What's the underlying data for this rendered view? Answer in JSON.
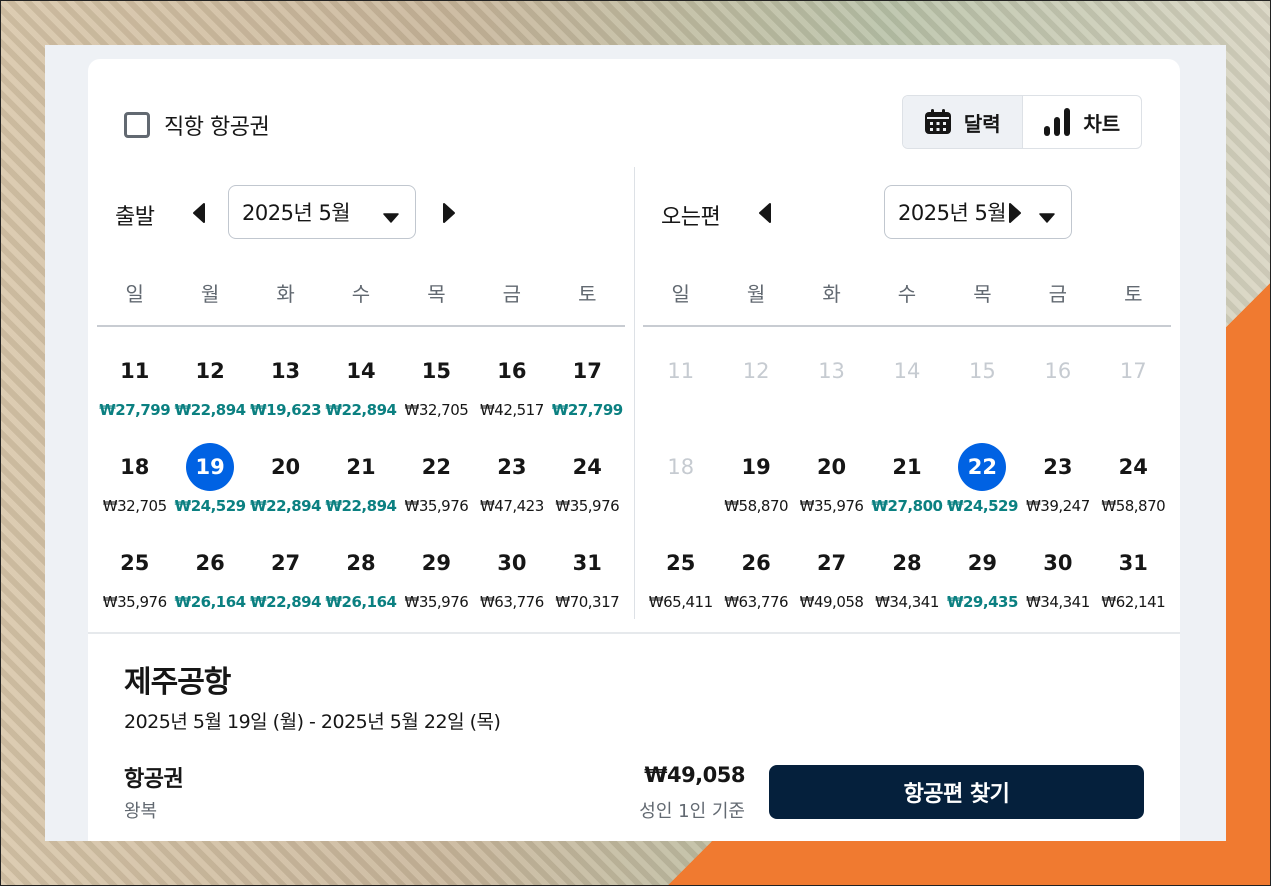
{
  "colors": {
    "accent": "#0062e3",
    "cheap_price": "#0b8081",
    "button_bg": "#05203c",
    "text": "#161616",
    "muted": "#626971",
    "disabled": "#c6cbd1"
  },
  "filters": {
    "direct_label": "직항 항공권",
    "direct_checked": false
  },
  "view_toggle": [
    {
      "label": "달력",
      "icon": "calendar-icon",
      "active": true
    },
    {
      "label": "차트",
      "icon": "bar-chart-icon",
      "active": false
    }
  ],
  "weekdays": [
    "일",
    "월",
    "화",
    "수",
    "목",
    "금",
    "토"
  ],
  "depart": {
    "label": "출발",
    "month": "2025년 5월",
    "rows": [
      [
        {
          "d": "11",
          "p": "₩27,799",
          "cheap": true
        },
        {
          "d": "12",
          "p": "₩22,894",
          "cheap": true
        },
        {
          "d": "13",
          "p": "₩19,623",
          "cheap": true
        },
        {
          "d": "14",
          "p": "₩22,894",
          "cheap": true
        },
        {
          "d": "15",
          "p": "₩32,705",
          "cheap": false
        },
        {
          "d": "16",
          "p": "₩42,517",
          "cheap": false
        },
        {
          "d": "17",
          "p": "₩27,799",
          "cheap": true
        }
      ],
      [
        {
          "d": "18",
          "p": "₩32,705",
          "cheap": false
        },
        {
          "d": "19",
          "p": "₩24,529",
          "cheap": true,
          "selected": true
        },
        {
          "d": "20",
          "p": "₩22,894",
          "cheap": true
        },
        {
          "d": "21",
          "p": "₩22,894",
          "cheap": true
        },
        {
          "d": "22",
          "p": "₩35,976",
          "cheap": false
        },
        {
          "d": "23",
          "p": "₩47,423",
          "cheap": false
        },
        {
          "d": "24",
          "p": "₩35,976",
          "cheap": false
        }
      ],
      [
        {
          "d": "25",
          "p": "₩35,976",
          "cheap": false
        },
        {
          "d": "26",
          "p": "₩26,164",
          "cheap": true
        },
        {
          "d": "27",
          "p": "₩22,894",
          "cheap": true
        },
        {
          "d": "28",
          "p": "₩26,164",
          "cheap": true
        },
        {
          "d": "29",
          "p": "₩35,976",
          "cheap": false
        },
        {
          "d": "30",
          "p": "₩63,776",
          "cheap": false
        },
        {
          "d": "31",
          "p": "₩70,317",
          "cheap": false
        }
      ]
    ]
  },
  "return": {
    "label": "오는편",
    "month": "2025년 5월",
    "rows": [
      [
        {
          "d": "11",
          "p": "",
          "disabled": true
        },
        {
          "d": "12",
          "p": "",
          "disabled": true
        },
        {
          "d": "13",
          "p": "",
          "disabled": true
        },
        {
          "d": "14",
          "p": "",
          "disabled": true
        },
        {
          "d": "15",
          "p": "",
          "disabled": true
        },
        {
          "d": "16",
          "p": "",
          "disabled": true
        },
        {
          "d": "17",
          "p": "",
          "disabled": true
        }
      ],
      [
        {
          "d": "18",
          "p": "",
          "disabled": true
        },
        {
          "d": "19",
          "p": "₩58,870",
          "cheap": false
        },
        {
          "d": "20",
          "p": "₩35,976",
          "cheap": false
        },
        {
          "d": "21",
          "p": "₩27,800",
          "cheap": true
        },
        {
          "d": "22",
          "p": "₩24,529",
          "cheap": true,
          "selected": true
        },
        {
          "d": "23",
          "p": "₩39,247",
          "cheap": false
        },
        {
          "d": "24",
          "p": "₩58,870",
          "cheap": false
        }
      ],
      [
        {
          "d": "25",
          "p": "₩65,411",
          "cheap": false
        },
        {
          "d": "26",
          "p": "₩63,776",
          "cheap": false
        },
        {
          "d": "27",
          "p": "₩49,058",
          "cheap": false
        },
        {
          "d": "28",
          "p": "₩34,341",
          "cheap": false
        },
        {
          "d": "29",
          "p": "₩29,435",
          "cheap": true
        },
        {
          "d": "30",
          "p": "₩34,341",
          "cheap": false
        },
        {
          "d": "31",
          "p": "₩62,141",
          "cheap": false
        }
      ]
    ]
  },
  "summary": {
    "destination": "제주공항",
    "date_range": "2025년 5월 19일 (월) - 2025년 5월 22일 (목)",
    "ticket_label": "항공권",
    "trip_type": "왕복",
    "price": "₩49,058",
    "price_basis": "성인 1인 기준",
    "search_button": "항공편 찾기"
  }
}
